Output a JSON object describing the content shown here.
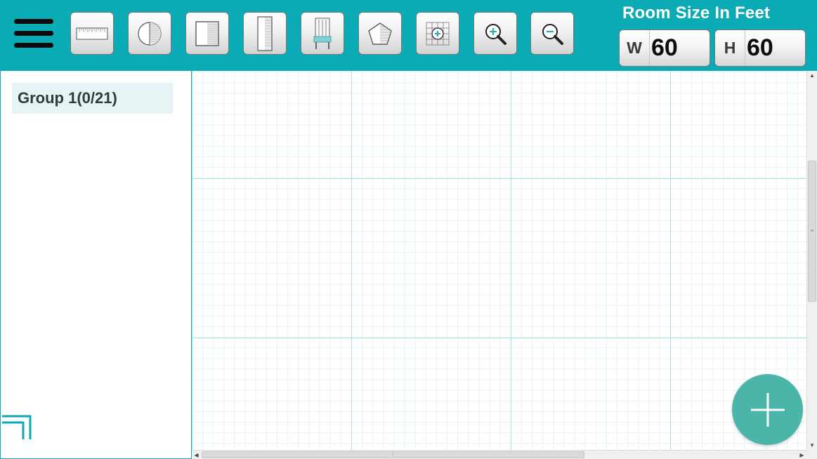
{
  "colors": {
    "toolbar_bg": "#0aabb4",
    "grid_major": "#b4e0e4",
    "grid_minor": "#e4f3f4",
    "fab_bg": "#4bb5aa",
    "group_bg": "#e6f4f6"
  },
  "toolbar": {
    "menu_icon": "hamburger-menu-icon",
    "tools": [
      {
        "name": "ruler-wall-tool",
        "icon": "ruler-icon"
      },
      {
        "name": "round-table-tool",
        "icon": "half-circle-icon"
      },
      {
        "name": "rectangle-table-tool",
        "icon": "half-square-icon"
      },
      {
        "name": "long-table-tool",
        "icon": "tall-rectangle-icon"
      },
      {
        "name": "chair-tool",
        "icon": "chair-icon"
      },
      {
        "name": "polygon-tool",
        "icon": "pentagon-icon"
      },
      {
        "name": "fit-to-grid-tool",
        "icon": "grid-crosshair-icon"
      },
      {
        "name": "zoom-in-tool",
        "icon": "zoom-in-icon"
      },
      {
        "name": "zoom-out-tool",
        "icon": "zoom-out-icon"
      }
    ]
  },
  "room_size": {
    "title": "Room Size In Feet",
    "width_prefix": "W",
    "width_value": "60",
    "height_prefix": "H",
    "height_value": "60"
  },
  "sidebar": {
    "groups": [
      {
        "label": "Group 1(0/21)"
      }
    ],
    "corner_icon": "corner-bracket-icon"
  },
  "canvas": {
    "fab_icon": "plus-icon"
  }
}
